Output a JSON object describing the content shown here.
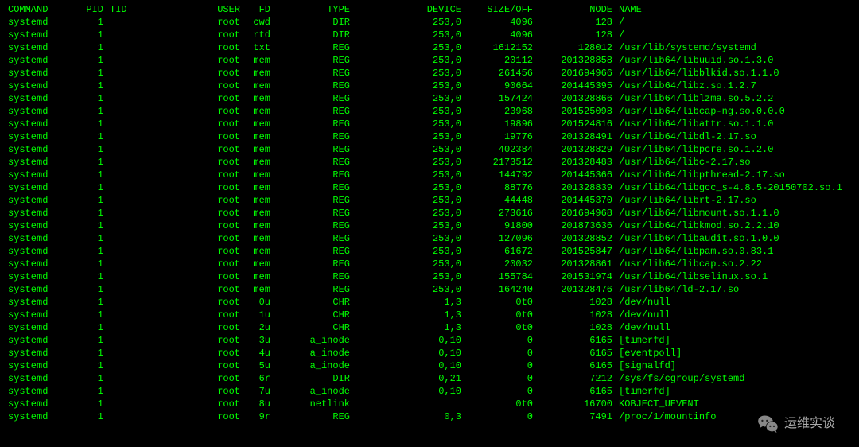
{
  "headers": {
    "command": "COMMAND",
    "pid": "PID",
    "tid": "TID",
    "user": "USER",
    "fd": "FD",
    "type": "TYPE",
    "device": "DEVICE",
    "size": "SIZE/OFF",
    "node": "NODE",
    "name": "NAME"
  },
  "rows": [
    {
      "command": "systemd",
      "pid": "1",
      "tid": "",
      "user": "root",
      "fd": "cwd",
      "type": "DIR",
      "device": "253,0",
      "size": "4096",
      "node": "128",
      "name": "/"
    },
    {
      "command": "systemd",
      "pid": "1",
      "tid": "",
      "user": "root",
      "fd": "rtd",
      "type": "DIR",
      "device": "253,0",
      "size": "4096",
      "node": "128",
      "name": "/"
    },
    {
      "command": "systemd",
      "pid": "1",
      "tid": "",
      "user": "root",
      "fd": "txt",
      "type": "REG",
      "device": "253,0",
      "size": "1612152",
      "node": "128012",
      "name": "/usr/lib/systemd/systemd"
    },
    {
      "command": "systemd",
      "pid": "1",
      "tid": "",
      "user": "root",
      "fd": "mem",
      "type": "REG",
      "device": "253,0",
      "size": "20112",
      "node": "201328858",
      "name": "/usr/lib64/libuuid.so.1.3.0"
    },
    {
      "command": "systemd",
      "pid": "1",
      "tid": "",
      "user": "root",
      "fd": "mem",
      "type": "REG",
      "device": "253,0",
      "size": "261456",
      "node": "201694966",
      "name": "/usr/lib64/libblkid.so.1.1.0"
    },
    {
      "command": "systemd",
      "pid": "1",
      "tid": "",
      "user": "root",
      "fd": "mem",
      "type": "REG",
      "device": "253,0",
      "size": "90664",
      "node": "201445395",
      "name": "/usr/lib64/libz.so.1.2.7"
    },
    {
      "command": "systemd",
      "pid": "1",
      "tid": "",
      "user": "root",
      "fd": "mem",
      "type": "REG",
      "device": "253,0",
      "size": "157424",
      "node": "201328866",
      "name": "/usr/lib64/liblzma.so.5.2.2"
    },
    {
      "command": "systemd",
      "pid": "1",
      "tid": "",
      "user": "root",
      "fd": "mem",
      "type": "REG",
      "device": "253,0",
      "size": "23968",
      "node": "201525098",
      "name": "/usr/lib64/libcap-ng.so.0.0.0"
    },
    {
      "command": "systemd",
      "pid": "1",
      "tid": "",
      "user": "root",
      "fd": "mem",
      "type": "REG",
      "device": "253,0",
      "size": "19896",
      "node": "201524816",
      "name": "/usr/lib64/libattr.so.1.1.0"
    },
    {
      "command": "systemd",
      "pid": "1",
      "tid": "",
      "user": "root",
      "fd": "mem",
      "type": "REG",
      "device": "253,0",
      "size": "19776",
      "node": "201328491",
      "name": "/usr/lib64/libdl-2.17.so"
    },
    {
      "command": "systemd",
      "pid": "1",
      "tid": "",
      "user": "root",
      "fd": "mem",
      "type": "REG",
      "device": "253,0",
      "size": "402384",
      "node": "201328829",
      "name": "/usr/lib64/libpcre.so.1.2.0"
    },
    {
      "command": "systemd",
      "pid": "1",
      "tid": "",
      "user": "root",
      "fd": "mem",
      "type": "REG",
      "device": "253,0",
      "size": "2173512",
      "node": "201328483",
      "name": "/usr/lib64/libc-2.17.so"
    },
    {
      "command": "systemd",
      "pid": "1",
      "tid": "",
      "user": "root",
      "fd": "mem",
      "type": "REG",
      "device": "253,0",
      "size": "144792",
      "node": "201445366",
      "name": "/usr/lib64/libpthread-2.17.so"
    },
    {
      "command": "systemd",
      "pid": "1",
      "tid": "",
      "user": "root",
      "fd": "mem",
      "type": "REG",
      "device": "253,0",
      "size": "88776",
      "node": "201328839",
      "name": "/usr/lib64/libgcc_s-4.8.5-20150702.so.1"
    },
    {
      "command": "systemd",
      "pid": "1",
      "tid": "",
      "user": "root",
      "fd": "mem",
      "type": "REG",
      "device": "253,0",
      "size": "44448",
      "node": "201445370",
      "name": "/usr/lib64/librt-2.17.so"
    },
    {
      "command": "systemd",
      "pid": "1",
      "tid": "",
      "user": "root",
      "fd": "mem",
      "type": "REG",
      "device": "253,0",
      "size": "273616",
      "node": "201694968",
      "name": "/usr/lib64/libmount.so.1.1.0"
    },
    {
      "command": "systemd",
      "pid": "1",
      "tid": "",
      "user": "root",
      "fd": "mem",
      "type": "REG",
      "device": "253,0",
      "size": "91800",
      "node": "201873636",
      "name": "/usr/lib64/libkmod.so.2.2.10"
    },
    {
      "command": "systemd",
      "pid": "1",
      "tid": "",
      "user": "root",
      "fd": "mem",
      "type": "REG",
      "device": "253,0",
      "size": "127096",
      "node": "201328852",
      "name": "/usr/lib64/libaudit.so.1.0.0"
    },
    {
      "command": "systemd",
      "pid": "1",
      "tid": "",
      "user": "root",
      "fd": "mem",
      "type": "REG",
      "device": "253,0",
      "size": "61672",
      "node": "201525847",
      "name": "/usr/lib64/libpam.so.0.83.1"
    },
    {
      "command": "systemd",
      "pid": "1",
      "tid": "",
      "user": "root",
      "fd": "mem",
      "type": "REG",
      "device": "253,0",
      "size": "20032",
      "node": "201328861",
      "name": "/usr/lib64/libcap.so.2.22"
    },
    {
      "command": "systemd",
      "pid": "1",
      "tid": "",
      "user": "root",
      "fd": "mem",
      "type": "REG",
      "device": "253,0",
      "size": "155784",
      "node": "201531974",
      "name": "/usr/lib64/libselinux.so.1"
    },
    {
      "command": "systemd",
      "pid": "1",
      "tid": "",
      "user": "root",
      "fd": "mem",
      "type": "REG",
      "device": "253,0",
      "size": "164240",
      "node": "201328476",
      "name": "/usr/lib64/ld-2.17.so"
    },
    {
      "command": "systemd",
      "pid": "1",
      "tid": "",
      "user": "root",
      "fd": "0u",
      "type": "CHR",
      "device": "1,3",
      "size": "0t0",
      "node": "1028",
      "name": "/dev/null"
    },
    {
      "command": "systemd",
      "pid": "1",
      "tid": "",
      "user": "root",
      "fd": "1u",
      "type": "CHR",
      "device": "1,3",
      "size": "0t0",
      "node": "1028",
      "name": "/dev/null"
    },
    {
      "command": "systemd",
      "pid": "1",
      "tid": "",
      "user": "root",
      "fd": "2u",
      "type": "CHR",
      "device": "1,3",
      "size": "0t0",
      "node": "1028",
      "name": "/dev/null"
    },
    {
      "command": "systemd",
      "pid": "1",
      "tid": "",
      "user": "root",
      "fd": "3u",
      "type": "a_inode",
      "device": "0,10",
      "size": "0",
      "node": "6165",
      "name": "[timerfd]"
    },
    {
      "command": "systemd",
      "pid": "1",
      "tid": "",
      "user": "root",
      "fd": "4u",
      "type": "a_inode",
      "device": "0,10",
      "size": "0",
      "node": "6165",
      "name": "[eventpoll]"
    },
    {
      "command": "systemd",
      "pid": "1",
      "tid": "",
      "user": "root",
      "fd": "5u",
      "type": "a_inode",
      "device": "0,10",
      "size": "0",
      "node": "6165",
      "name": "[signalfd]"
    },
    {
      "command": "systemd",
      "pid": "1",
      "tid": "",
      "user": "root",
      "fd": "6r",
      "type": "DIR",
      "device": "0,21",
      "size": "0",
      "node": "7212",
      "name": "/sys/fs/cgroup/systemd"
    },
    {
      "command": "systemd",
      "pid": "1",
      "tid": "",
      "user": "root",
      "fd": "7u",
      "type": "a_inode",
      "device": "0,10",
      "size": "0",
      "node": "6165",
      "name": "[timerfd]"
    },
    {
      "command": "systemd",
      "pid": "1",
      "tid": "",
      "user": "root",
      "fd": "8u",
      "type": "netlink",
      "device": "",
      "size": "0t0",
      "node": "16700",
      "name": "KOBJECT_UEVENT"
    },
    {
      "command": "systemd",
      "pid": "1",
      "tid": "",
      "user": "root",
      "fd": "9r",
      "type": "REG",
      "device": "0,3",
      "size": "0",
      "node": "7491",
      "name": "/proc/1/mountinfo"
    }
  ],
  "overlay": {
    "text": "运维实谈"
  }
}
